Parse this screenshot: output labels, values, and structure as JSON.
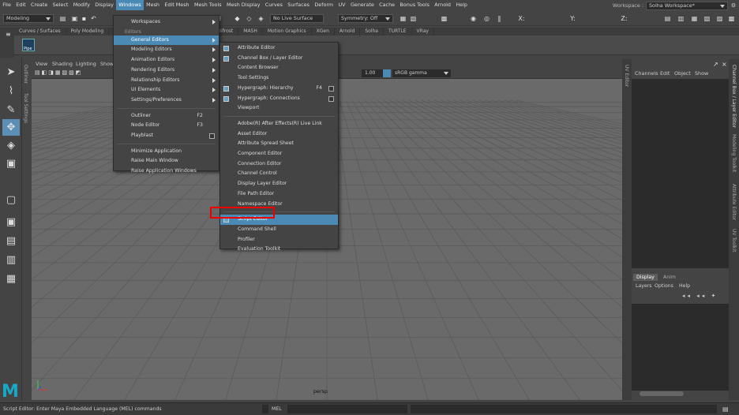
{
  "menubar": [
    "File",
    "Edit",
    "Create",
    "Select",
    "Modify",
    "Display",
    "Windows",
    "Mesh",
    "Edit Mesh",
    "Mesh Tools",
    "Mesh Display",
    "Curves",
    "Surfaces",
    "Deform",
    "UV",
    "Generate",
    "Cache",
    "Bonus Tools",
    "Arnold",
    "Help"
  ],
  "menubar_active": "Windows",
  "workspace": {
    "label": "Workspace :",
    "value": "Solha Workspace*"
  },
  "toolbar": {
    "mode": "Modeling",
    "live_surface": "No Live Surface",
    "symmetry": "Symmetry: Off"
  },
  "shelf_tabs": [
    "Curves / Surfaces",
    "Poly Modeling",
    "ering",
    "FX",
    "FX Caching",
    "Custom",
    "Bifrost",
    "MASH",
    "Motion Graphics",
    "XGen",
    "Arnold",
    "Solha",
    "TURTLE",
    "VRay"
  ],
  "shelf_active": "Custom",
  "shelf_item": "Pipe",
  "viewport": {
    "menu": [
      "View",
      "Shading",
      "Lighting",
      "Show"
    ],
    "field_value": "1.00",
    "color_space": "sRGB gamma",
    "camera": "persp"
  },
  "side_tabs": {
    "left_outer": "Outliner",
    "left_inner": "Tool Settings",
    "uv": "UV Editor",
    "right": [
      "Channel Box / Layer Editor",
      "Modeling Toolkit",
      "Attribute Editor",
      "UV Toolkit"
    ]
  },
  "windows_menu": {
    "items": [
      {
        "label": "Workspaces",
        "submenu": true
      },
      {
        "section": "Editors"
      },
      {
        "label": "General Editors",
        "submenu": true,
        "highlighted": true
      },
      {
        "label": "Modeling Editors",
        "submenu": true
      },
      {
        "label": "Animation Editors",
        "submenu": true
      },
      {
        "label": "Rendering Editors",
        "submenu": true
      },
      {
        "label": "Relationship Editors",
        "submenu": true
      },
      {
        "label": "UI Elements",
        "submenu": true
      },
      {
        "label": "Settings/Preferences",
        "submenu": true
      },
      {
        "separator": true
      },
      {
        "label": "Outliner",
        "shortcut": "F2"
      },
      {
        "label": "Node Editor",
        "shortcut": "F3"
      },
      {
        "label": "Playblast",
        "checkbox": true
      },
      {
        "separator": true
      },
      {
        "label": "Minimize Application"
      },
      {
        "label": "Raise Main Window"
      },
      {
        "label": "Raise Application Windows"
      }
    ]
  },
  "general_editors_menu": {
    "items": [
      {
        "label": "Attribute Editor",
        "icon": true
      },
      {
        "label": "Channel Box / Layer Editor",
        "icon": true
      },
      {
        "label": "Content Browser"
      },
      {
        "label": "Tool Settings"
      },
      {
        "label": "Hypergraph: Hierarchy",
        "shortcut": "F4",
        "checkbox": true,
        "icon": true
      },
      {
        "label": "Hypergraph: Connections",
        "checkbox": true,
        "icon": true
      },
      {
        "label": "Viewport"
      },
      {
        "separator": true
      },
      {
        "label": "Adobe(R) After Effects(R) Live Link"
      },
      {
        "label": "Asset Editor"
      },
      {
        "label": "Attribute Spread Sheet"
      },
      {
        "label": "Component Editor"
      },
      {
        "label": "Connection Editor"
      },
      {
        "label": "Channel Control"
      },
      {
        "label": "Display Layer Editor"
      },
      {
        "label": "File Path Editor"
      },
      {
        "label": "Namespace Editor"
      },
      {
        "separator": true
      },
      {
        "label": "Script Editor",
        "highlighted": true,
        "icon": true
      },
      {
        "label": "Command Shell"
      },
      {
        "label": "Profiler"
      },
      {
        "label": "Evaluation Toolkit"
      }
    ]
  },
  "channel_box": {
    "menu": [
      "Channels",
      "Edit",
      "Object",
      "Show"
    ]
  },
  "layer_editor": {
    "tabs": [
      "Display",
      "Anim"
    ],
    "menu": [
      "Layers",
      "Options",
      "Help"
    ]
  },
  "status_bar": {
    "message": "Script Editor: Enter Maya Embedded Language (MEL) commands",
    "mel_label": "MEL"
  },
  "colors": {
    "highlight": "#4a8ab5",
    "callout": "#e00000",
    "viewport": "#6a6a6a"
  }
}
